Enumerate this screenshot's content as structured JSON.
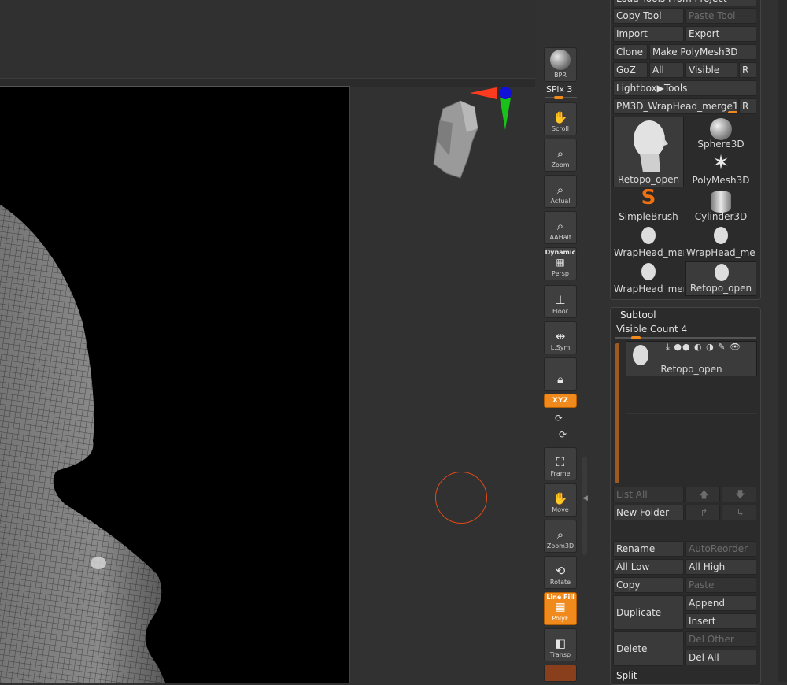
{
  "tool_palette": {
    "top_partial_label": "Load Tools From Project",
    "copy_tool": "Copy Tool",
    "paste_tool": "Paste Tool",
    "import": "Import",
    "export": "Export",
    "clone": "Clone",
    "make_polymesh": "Make PolyMesh3D",
    "goz": "GoZ",
    "all": "All",
    "visible": "Visible",
    "r": "R",
    "lightbox_tools": "Lightbox▶Tools",
    "current_tool": "PM3D_WrapHead_merge1.",
    "current_tool_slider": 0.9,
    "thumbnails": [
      {
        "label": "Retopo_open",
        "icon": "head-icon"
      },
      {
        "label": "Sphere3D",
        "icon": "sphere-icon"
      },
      {
        "label": "PolyMesh3D",
        "icon": "star-icon"
      },
      {
        "label": "SimpleBrush",
        "icon": "simplebrush-icon"
      },
      {
        "label": "Cylinder3D",
        "icon": "cylinder-icon"
      },
      {
        "label": "WrapHead_merg",
        "icon": "head-icon"
      },
      {
        "label": "WrapHead_merg",
        "icon": "head-icon"
      },
      {
        "label": "WrapHead_merg",
        "icon": "head-icon"
      },
      {
        "label": "Retopo_open",
        "icon": "head-icon"
      }
    ]
  },
  "subtool": {
    "title": "Subtool",
    "visible_count": "Visible Count 4",
    "visible_count_slider": 0.12,
    "active_item": "Retopo_open",
    "list_all": "List All",
    "new_folder": "New Folder",
    "rename": "Rename",
    "auto_reorder": "AutoReorder",
    "all_low": "All Low",
    "all_high": "All High",
    "copy": "Copy",
    "paste": "Paste",
    "duplicate": "Duplicate",
    "append": "Append",
    "insert": "Insert",
    "delete": "Delete",
    "del_other": "Del Other",
    "del_all": "Del All",
    "split": "Split"
  },
  "shelf": {
    "bpr": "BPR",
    "spix": "SPix 3",
    "spix_slider": 0.5,
    "scroll": "Scroll",
    "zoom": "Zoom",
    "actual": "Actual",
    "aahalf": "AAHalf",
    "dynamic": "Dynamic",
    "persp": "Persp",
    "floor": "Floor",
    "lsym": "L.Sym",
    "xyz": "XYZ",
    "frame": "Frame",
    "move": "Move",
    "zoom3d": "Zoom3D",
    "rotate": "Rotate",
    "line_fill": "Line Fill",
    "polyf": "PolyF",
    "transp": "Transp"
  },
  "colors": {
    "accent": "#f08a1c",
    "panel_bg": "#2b2b2b",
    "button_bg": "#3a3a3a",
    "gizmo_x": "#ff3b1f",
    "gizmo_y": "#18c218",
    "gizmo_z": "#1010d8",
    "brush_ring": "#e04a16"
  }
}
